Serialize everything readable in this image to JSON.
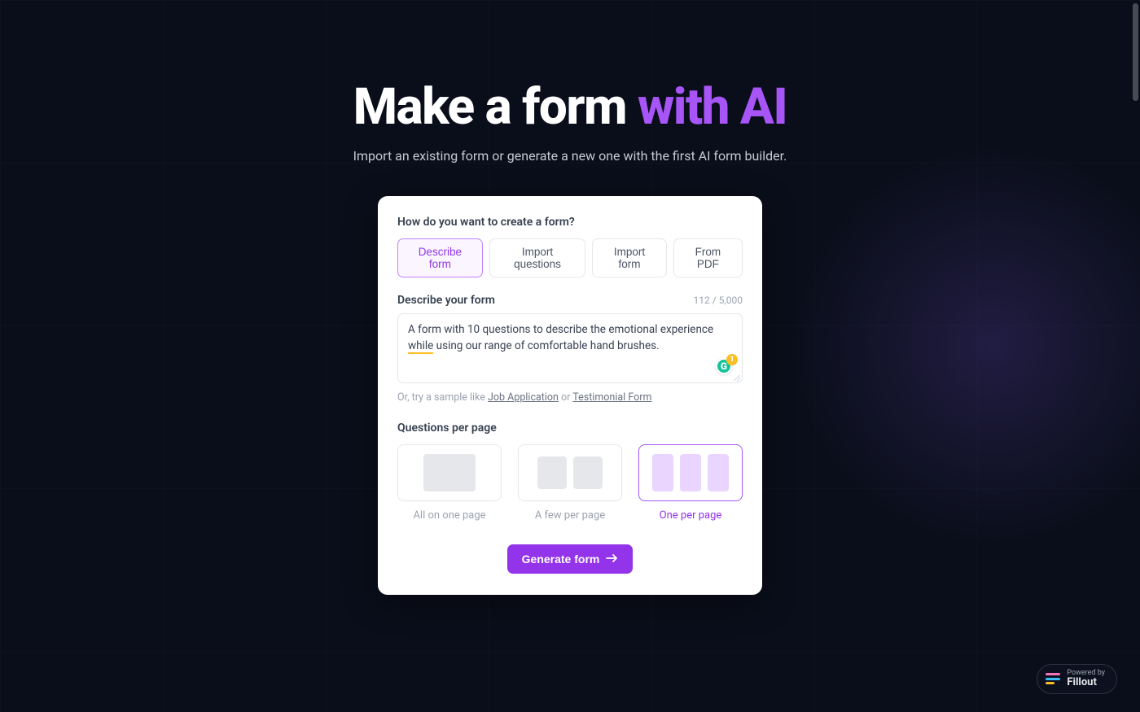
{
  "hero": {
    "title_prefix": "Make a form ",
    "title_accent": "with AI",
    "subtitle": "Import an existing form or generate a new one with the first AI form builder."
  },
  "card": {
    "how_label": "How do you want to create a form?",
    "tabs": [
      {
        "label": "Describe form",
        "active": true
      },
      {
        "label": "Import questions",
        "active": false
      },
      {
        "label": "Import form",
        "active": false
      },
      {
        "label": "From PDF",
        "active": false
      }
    ],
    "describe": {
      "label": "Describe your form",
      "char_count": "112 / 5,000",
      "text_before": "A form with 10 questions to describe the emotional experience ",
      "text_flag": "while",
      "text_after": " using our range of comfortable hand brushes."
    },
    "grammarly_count": "1",
    "sample": {
      "prefix": "Or, try a sample like ",
      "link1": "Job Application",
      "sep": " or ",
      "link2": "Testimonial Form"
    },
    "qpp": {
      "label": "Questions per page",
      "options": [
        {
          "caption": "All on one page",
          "active": false
        },
        {
          "caption": "A few per page",
          "active": false
        },
        {
          "caption": "One per page",
          "active": true
        }
      ]
    },
    "generate_label": "Generate form"
  },
  "footer": {
    "powered_by": "Powered by",
    "brand": "Fillout"
  }
}
